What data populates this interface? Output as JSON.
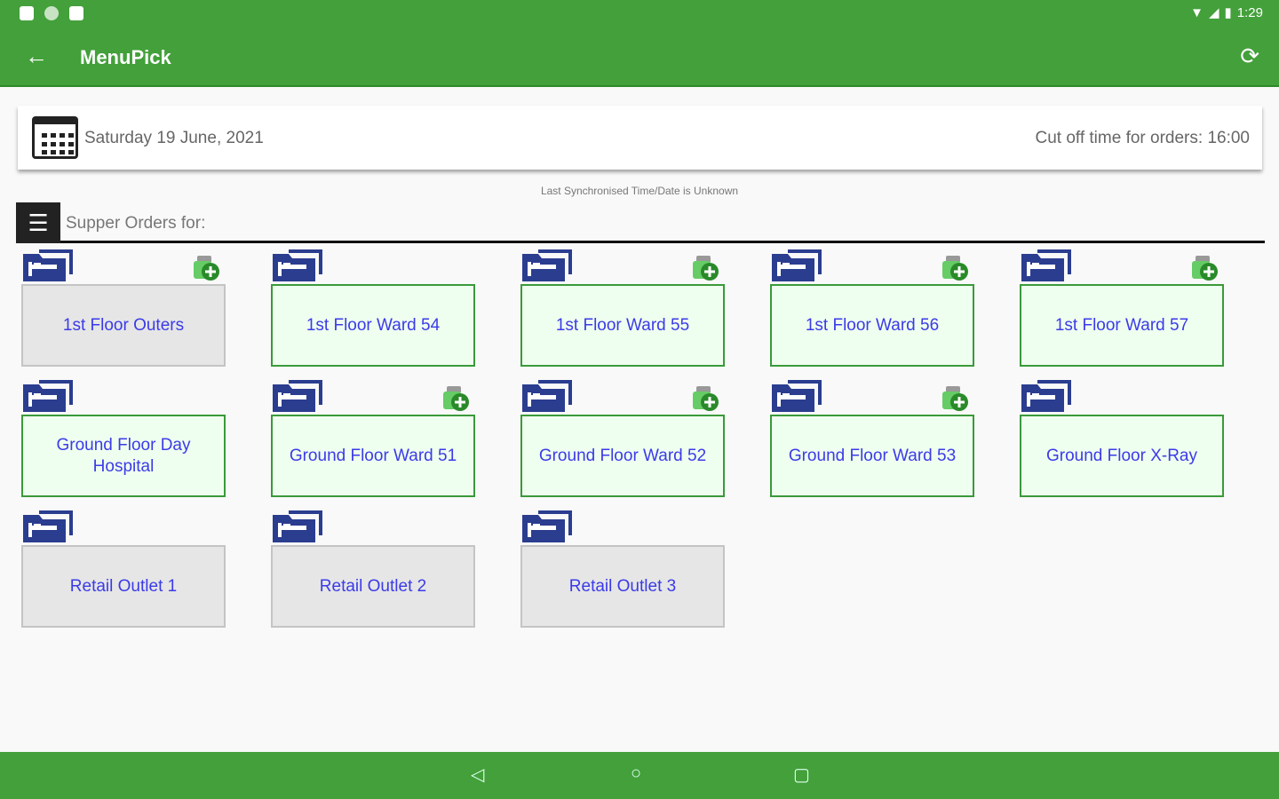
{
  "status_bar": {
    "time": "1:29"
  },
  "app_bar": {
    "title": "MenuPick"
  },
  "date_bar": {
    "date": "Saturday 19 June, 2021",
    "cutoff": "Cut off time for orders: 16:00"
  },
  "sync_status": "Last Synchronised Time/Date is Unknown",
  "section": {
    "label": "Supper Orders for:"
  },
  "wards": [
    {
      "label": "1st Floor Outers",
      "style": "grey",
      "has_add": true
    },
    {
      "label": "1st Floor Ward 54",
      "style": "green",
      "has_add": false
    },
    {
      "label": "1st Floor Ward 55",
      "style": "green",
      "has_add": true
    },
    {
      "label": "1st Floor Ward 56",
      "style": "green",
      "has_add": true
    },
    {
      "label": "1st Floor Ward 57",
      "style": "green",
      "has_add": true
    },
    {
      "label": "Ground Floor Day Hospital",
      "style": "green",
      "has_add": false
    },
    {
      "label": "Ground Floor Ward 51",
      "style": "green",
      "has_add": true
    },
    {
      "label": "Ground Floor Ward 52",
      "style": "green",
      "has_add": true
    },
    {
      "label": "Ground Floor Ward 53",
      "style": "green",
      "has_add": true
    },
    {
      "label": "Ground Floor X-Ray",
      "style": "green",
      "has_add": false
    },
    {
      "label": "Retail Outlet 1",
      "style": "grey",
      "has_add": false
    },
    {
      "label": "Retail Outlet 2",
      "style": "grey",
      "has_add": false
    },
    {
      "label": "Retail Outlet 3",
      "style": "grey",
      "has_add": false
    }
  ],
  "colors": {
    "brand": "#43a03a",
    "tile_text": "#3b3be8",
    "folder": "#2b3d8f"
  }
}
